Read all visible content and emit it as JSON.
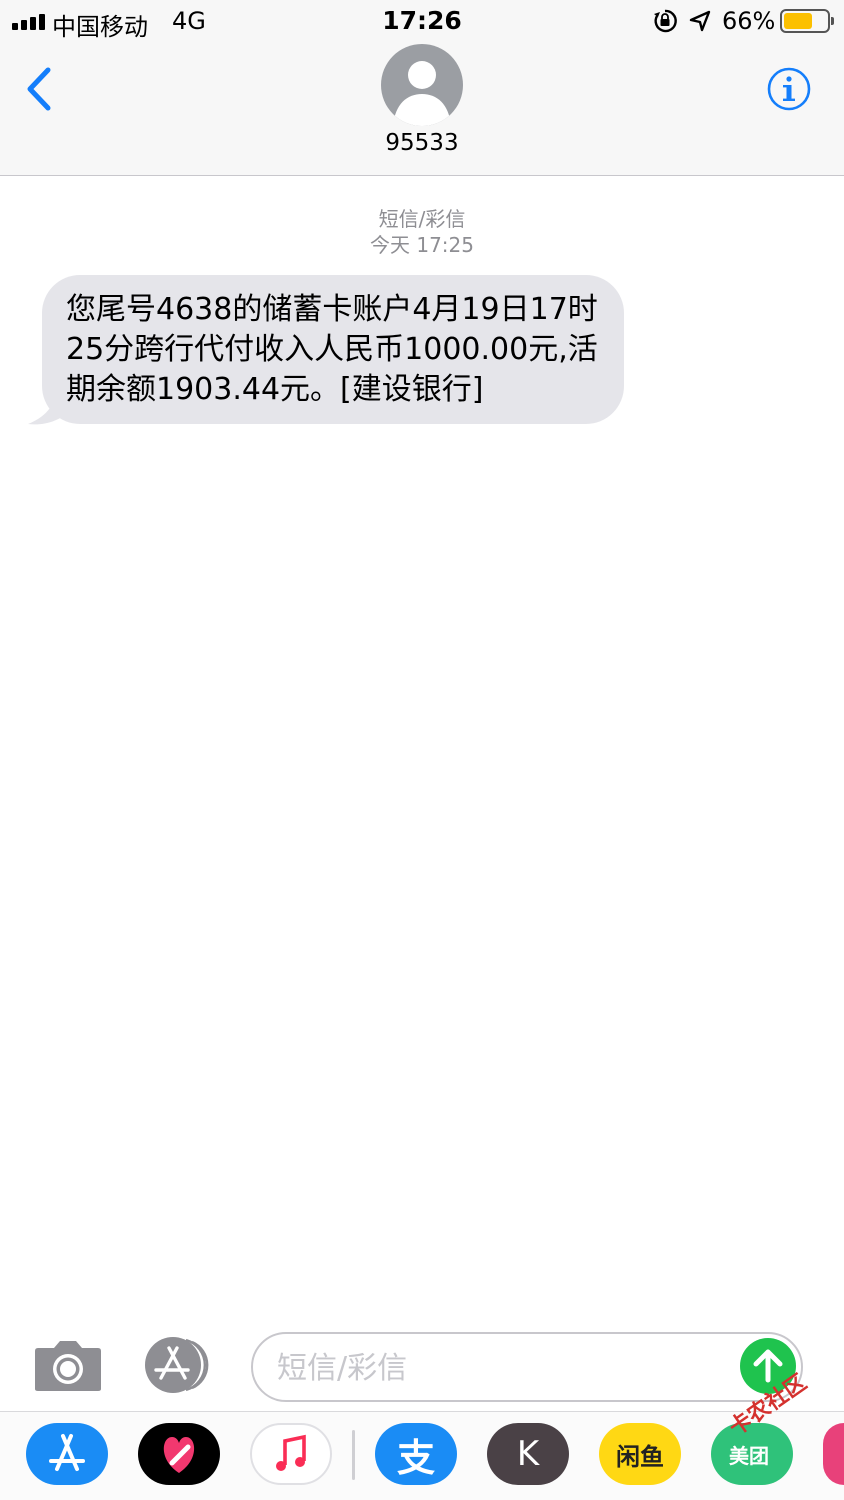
{
  "status_bar": {
    "carrier": "中国移动",
    "network": "4G",
    "time": "17:26",
    "battery_percent": "66%",
    "battery_level": 0.66,
    "icons": [
      "signal-icon",
      "orientation-lock-icon",
      "location-arrow-icon",
      "battery-icon"
    ]
  },
  "header": {
    "contact_name": "95533",
    "back_icon": "chevron-left-icon",
    "info_icon": "info-icon",
    "avatar_icon": "person-silhouette-icon"
  },
  "thread": {
    "message_type": "短信/彩信",
    "timestamp": "今天 17:25",
    "messages": [
      {
        "direction": "incoming",
        "text": "您尾号4638的储蓄卡账户4月19日17时25分跨行代付收入人民币1000.00元,活期余额1903.44元。[建设银行]"
      }
    ]
  },
  "composer": {
    "placeholder": "短信/彩信",
    "value": "",
    "camera_icon": "camera-icon",
    "appstore_icon": "app-store-icon",
    "send_icon": "send-arrow-icon"
  },
  "app_drawer": {
    "apps": [
      {
        "name": "app-store",
        "label": "",
        "color": "#1a8cf5"
      },
      {
        "name": "digital-touch",
        "label": "",
        "color": "#000000"
      },
      {
        "name": "music",
        "label": "",
        "color": "#ffffff"
      },
      {
        "name": "alipay",
        "label": "支",
        "color": "#1a8cf5"
      },
      {
        "name": "k-app",
        "label": "K",
        "color": "#4a4146"
      },
      {
        "name": "xianyu",
        "label": "闲鱼",
        "color": "#ffd814"
      },
      {
        "name": "meituan",
        "label": "美团",
        "color": "#2fc27a"
      }
    ]
  },
  "watermark": "卡农社区",
  "colors": {
    "accent": "#147efb",
    "send_green": "#1fc34e",
    "bubble_gray": "#e5e5ea",
    "meta_gray": "#8e8e93"
  }
}
